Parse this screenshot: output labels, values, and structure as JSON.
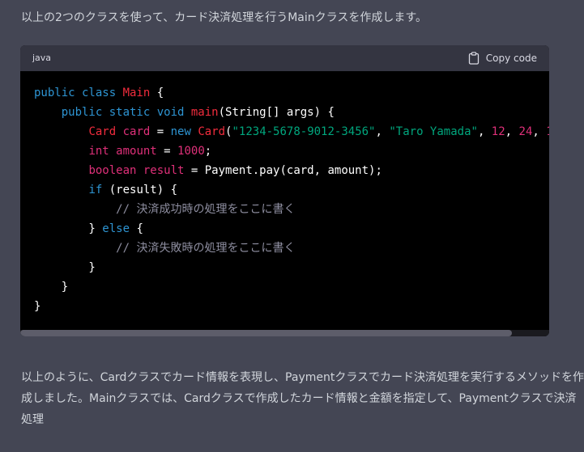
{
  "intro_text": "以上の2つのクラスを使って、カード決済処理を行うMainクラスを作成します。",
  "code_block": {
    "language": "java",
    "copy_label": "Copy code",
    "scroll_fraction_visible": 0.93,
    "lines": [
      [
        {
          "t": "public class ",
          "c": "kw"
        },
        {
          "t": "Main",
          "c": "cls"
        },
        {
          "t": " {",
          "c": ""
        }
      ],
      [
        {
          "t": "    public static void ",
          "c": "kw"
        },
        {
          "t": "main",
          "c": "fn"
        },
        {
          "t": "(String[] args) {",
          "c": ""
        }
      ],
      [
        {
          "t": "        ",
          "c": ""
        },
        {
          "t": "Card",
          "c": "cls"
        },
        {
          "t": " card",
          "c": "var"
        },
        {
          "t": " = ",
          "c": ""
        },
        {
          "t": "new ",
          "c": "kw"
        },
        {
          "t": "Card",
          "c": "cls"
        },
        {
          "t": "(",
          "c": ""
        },
        {
          "t": "\"1234-5678-9012-3456\"",
          "c": "str"
        },
        {
          "t": ", ",
          "c": ""
        },
        {
          "t": "\"Taro Yamada\"",
          "c": "str"
        },
        {
          "t": ", ",
          "c": ""
        },
        {
          "t": "12",
          "c": "num"
        },
        {
          "t": ", ",
          "c": ""
        },
        {
          "t": "24",
          "c": "num"
        },
        {
          "t": ", ",
          "c": ""
        },
        {
          "t": "1",
          "c": "num"
        }
      ],
      [
        {
          "t": "        ",
          "c": ""
        },
        {
          "t": "int",
          "c": "var"
        },
        {
          "t": " amount",
          "c": "var"
        },
        {
          "t": " = ",
          "c": ""
        },
        {
          "t": "1000",
          "c": "num"
        },
        {
          "t": ";",
          "c": ""
        }
      ],
      [
        {
          "t": "        ",
          "c": ""
        },
        {
          "t": "boolean",
          "c": "var"
        },
        {
          "t": " result",
          "c": "var"
        },
        {
          "t": " = Payment.pay(card, amount);",
          "c": ""
        }
      ],
      [
        {
          "t": "        ",
          "c": ""
        },
        {
          "t": "if",
          "c": "kw"
        },
        {
          "t": " (result) {",
          "c": ""
        }
      ],
      [
        {
          "t": "            ",
          "c": ""
        },
        {
          "t": "// 決済成功時の処理をここに書く",
          "c": "cm"
        }
      ],
      [
        {
          "t": "        } ",
          "c": ""
        },
        {
          "t": "else",
          "c": "kw"
        },
        {
          "t": " {",
          "c": ""
        }
      ],
      [
        {
          "t": "            ",
          "c": ""
        },
        {
          "t": "// 決済失敗時の処理をここに書く",
          "c": "cm"
        }
      ],
      [
        {
          "t": "        }",
          "c": ""
        }
      ],
      [
        {
          "t": "    }",
          "c": ""
        }
      ],
      [
        {
          "t": "}",
          "c": ""
        }
      ]
    ]
  },
  "outro_lines": [
    "以上のように、Cardクラスでカード情報を表現し、Paymentクラスでカード決済処理を実行するメソッドを作",
    "成しました。Mainクラスでは、Cardクラスで作成したカード情報と金額を指定して、Paymentクラスで決済",
    "処理"
  ],
  "icons": {
    "copy": "clipboard-icon"
  },
  "colors": {
    "background": "#444654",
    "code_background": "#000000",
    "code_header": "#343541",
    "keyword": "#2e95d3",
    "class_name": "#f22c3d",
    "number": "#df3079",
    "string": "#00a67d",
    "comment": "#8e8ea0"
  }
}
